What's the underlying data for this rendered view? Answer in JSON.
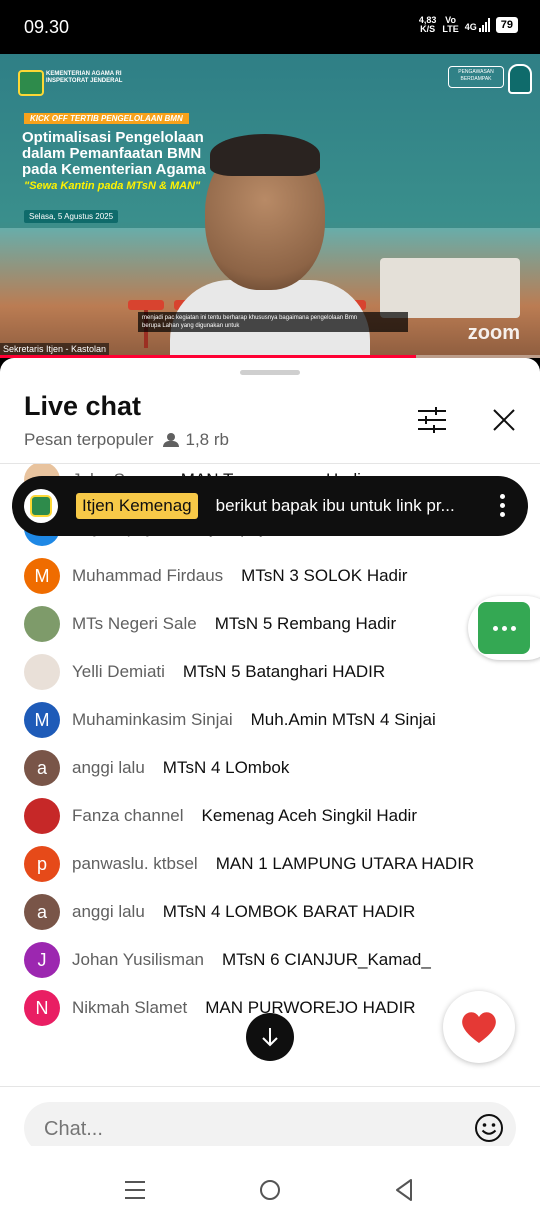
{
  "status_bar": {
    "time": "09.30",
    "net_speed_value": "4,83",
    "net_speed_unit": "K/S",
    "volte_top": "Vo",
    "volte_bottom": "LTE",
    "network": "4G",
    "battery": "79"
  },
  "video": {
    "org_line1": "KEMENTERIAN AGAMA RI",
    "org_line2": "INSPEKTORAT JENDERAL",
    "partner_logo": "PENGAWASAN BERDAMPAK",
    "partner_logo2": "pusaka",
    "kick_off": "KICK OFF TERTIB PENGELOLAAN BMN",
    "title_line1": "Optimalisasi Pengelolaan",
    "title_line2": "dalam Pemanfaatan BMN",
    "title_line3": "pada Kementerian Agama",
    "subtitle": "\"Sewa Kantin pada MTsN & MAN\"",
    "date": "Selasa, 5 Agustus 2025",
    "caption_line1": "menjadi pac kegiatan ini tentu berharap khususnya bagaimana pengelolaan Bmn",
    "caption_line2": "berupa Lahan yang digunakan untuk",
    "speaker_tag": "Sekretaris Itjen - Kastolan",
    "watermark": "zoom",
    "progress": 0.77
  },
  "chat": {
    "title": "Live chat",
    "mode": "Pesan terpopuler",
    "viewers": "1,8 rb",
    "pinned": {
      "author": "Itjen Kemenag",
      "text": "berikut bapak ibu untuk link pr..."
    },
    "messages": [
      {
        "author": "John Suneo",
        "text": "MAN Temanggung Hadir",
        "initial": "",
        "color": "#e8c39e"
      },
      {
        "author": "Eny Supriyati",
        "text": "eny supriyati, hadir",
        "initial": "E",
        "color": "#1e88e5"
      },
      {
        "author": "Muhammad Firdaus",
        "text": "MTsN 3 SOLOK Hadir",
        "initial": "M",
        "color": "#ef6c00"
      },
      {
        "author": "MTs Negeri Sale",
        "text": "MTsN 5 Rembang Hadir",
        "initial": "",
        "color": "#7e9b6a"
      },
      {
        "author": "Yelli Demiati",
        "text": "MTsN 5 Batanghari HADIR",
        "initial": "",
        "color": "#e9e0d8"
      },
      {
        "author": "Muhaminkasim Sinjai",
        "text": "Muh.Amin MTsN 4 Sinjai",
        "initial": "M",
        "color": "#1e5bb8"
      },
      {
        "author": "anggi lalu",
        "text": "MTsN 4 LOmbok",
        "initial": "a",
        "color": "#795548"
      },
      {
        "author": "Fanza channel",
        "text": "Kemenag Aceh Singkil Hadir",
        "initial": "",
        "color": "#c62828"
      },
      {
        "author": "panwaslu. ktbsel",
        "text": "MAN 1 LAMPUNG UTARA HADIR",
        "initial": "p",
        "color": "#e64a19"
      },
      {
        "author": "anggi lalu",
        "text": "MTsN 4 LOMBOK BARAT HADIR",
        "initial": "a",
        "color": "#795548"
      },
      {
        "author": "Johan Yusilisman",
        "text": "MTsN 6 CIANJUR_Kamad_",
        "initial": "J",
        "color": "#9c27b0"
      },
      {
        "author": "Nikmah Slamet",
        "text": "MAN PURWOREJO HADIR",
        "initial": "N",
        "color": "#e91e63"
      }
    ],
    "input_placeholder": "Chat..."
  },
  "colors": {
    "accent_red": "#ff0033",
    "badge_yellow": "#f7c948",
    "chat_green": "#34a853"
  },
  "icons": [
    "filter-icon",
    "close-icon",
    "more-vert-icon",
    "chat-dots-icon",
    "heart-icon",
    "arrow-down-icon",
    "emoji-icon",
    "nav-menu-icon",
    "nav-home-icon",
    "nav-back-icon"
  ]
}
